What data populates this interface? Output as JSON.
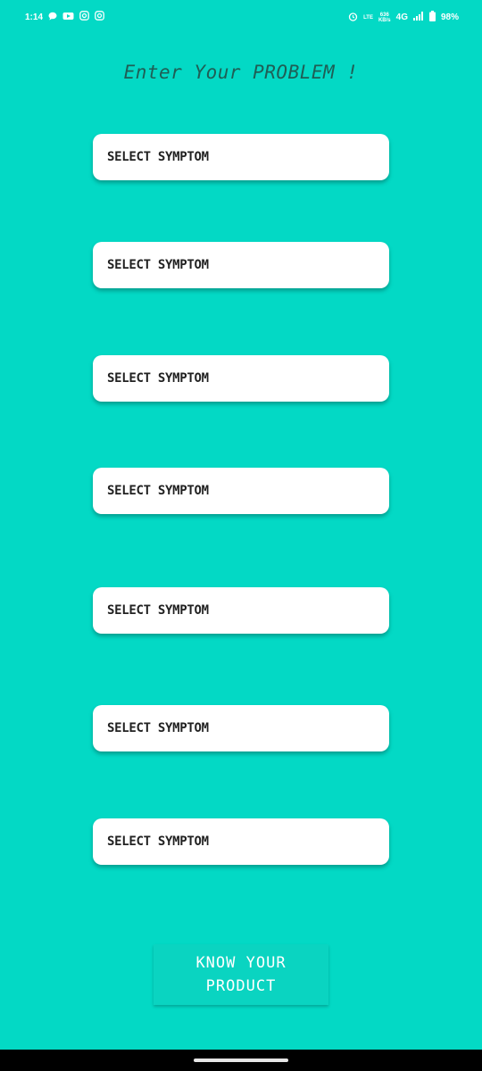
{
  "status_bar": {
    "time": "1:14",
    "network": "4G",
    "battery": "98%",
    "data_rate_value": "636",
    "data_rate_unit": "KB/s",
    "volte": "LTE"
  },
  "heading": "Enter Your PROBLEM !",
  "symptoms": [
    {
      "label": "SELECT SYMPTOM"
    },
    {
      "label": "SELECT SYMPTOM"
    },
    {
      "label": "SELECT SYMPTOM"
    },
    {
      "label": "SELECT SYMPTOM"
    },
    {
      "label": "SELECT SYMPTOM"
    },
    {
      "label": "SELECT SYMPTOM"
    },
    {
      "label": "SELECT SYMPTOM"
    }
  ],
  "button": {
    "label": "KNOW YOUR PRODUCT"
  },
  "colors": {
    "background": "#03D9C5",
    "heading": "#1f5e55",
    "field": "#ffffff",
    "button": "#0ad4c1"
  },
  "icons": [
    "chat-icon",
    "youtube-icon",
    "instagram-icon",
    "instagram-icon",
    "alarm-icon",
    "signal-icon",
    "battery-icon"
  ]
}
